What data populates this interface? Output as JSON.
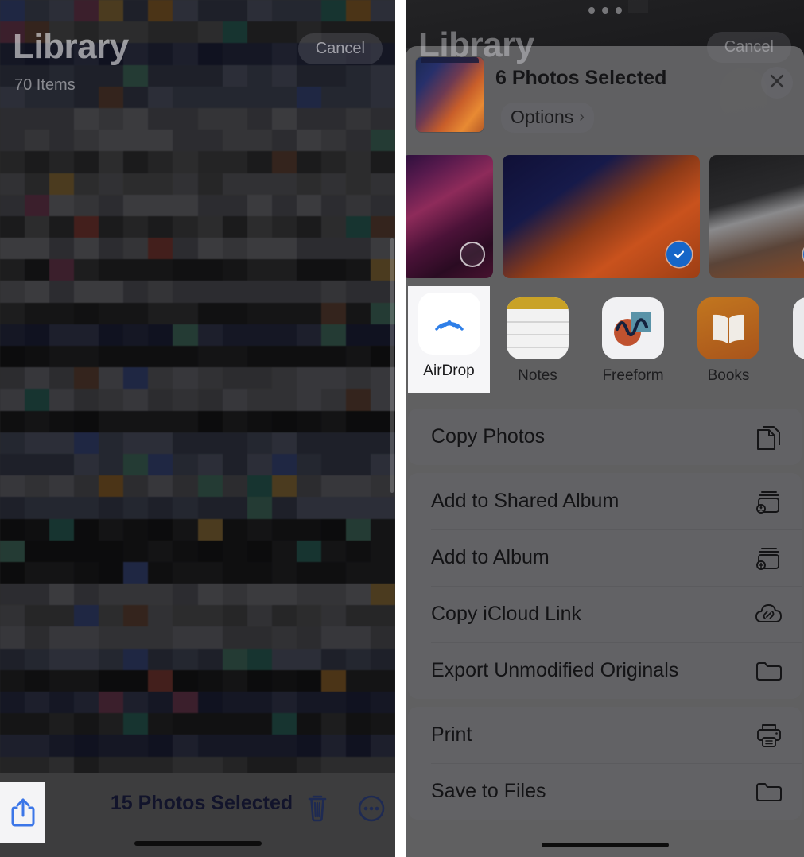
{
  "left_panel": {
    "title": "Library",
    "subtitle": "70 Items",
    "cancel_label": "Cancel",
    "bottom_bar": {
      "selection_text": "15 Photos Selected",
      "share_icon": "share-icon",
      "trash_icon": "trash-icon",
      "more_icon": "more-circle-icon"
    }
  },
  "right_panel": {
    "background": {
      "title": "Library",
      "cancel_label": "Cancel"
    },
    "share_sheet": {
      "header": {
        "title": "6 Photos Selected",
        "options_label": "Options",
        "chevron": "›",
        "close_icon": "close-icon",
        "thumbnail_icon": "photo-stack-thumbnail"
      },
      "thumbnails": [
        {
          "name": "photo-thumbnail-1",
          "selected": false
        },
        {
          "name": "photo-thumbnail-2",
          "selected": true
        },
        {
          "name": "photo-thumbnail-3",
          "selected": true
        }
      ],
      "apps": [
        {
          "label": "AirDrop",
          "icon": "airdrop-icon",
          "highlighted": true
        },
        {
          "label": "Notes",
          "icon": "notes-icon",
          "highlighted": false
        },
        {
          "label": "Freeform",
          "icon": "freeform-icon",
          "highlighted": false
        },
        {
          "label": "Books",
          "icon": "books-icon",
          "highlighted": false
        }
      ],
      "action_groups": [
        {
          "items": [
            {
              "label": "Copy Photos",
              "icon": "copy-documents-icon"
            }
          ]
        },
        {
          "items": [
            {
              "label": "Add to Shared Album",
              "icon": "shared-album-icon"
            },
            {
              "label": "Add to Album",
              "icon": "add-album-icon"
            },
            {
              "label": "Copy iCloud Link",
              "icon": "icloud-link-icon"
            },
            {
              "label": "Export Unmodified Originals",
              "icon": "folder-icon"
            }
          ]
        },
        {
          "items": [
            {
              "label": "Print",
              "icon": "printer-icon"
            },
            {
              "label": "Save to Files",
              "icon": "folder-icon"
            }
          ]
        }
      ]
    }
  },
  "colors": {
    "accent_blue": "#1666c8",
    "share_blue": "#3b76e8",
    "highlight_white": "#f6f6f8",
    "sheet_gray": "#606062"
  }
}
